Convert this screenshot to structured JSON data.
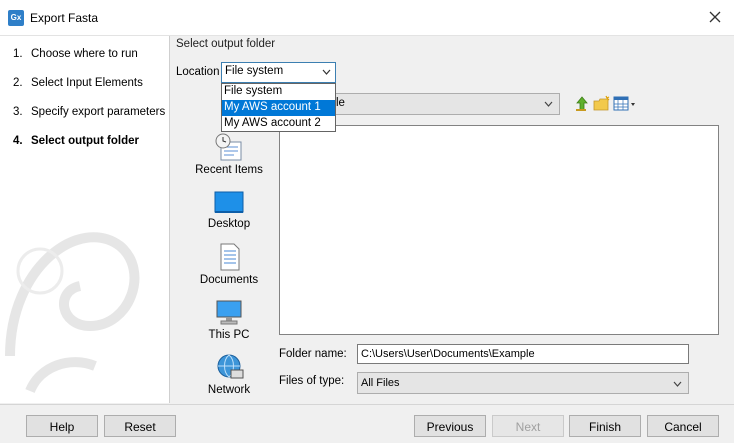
{
  "window": {
    "title": "Export Fasta",
    "app_icon_text": "Gx"
  },
  "steps": [
    {
      "num": "1.",
      "label": "Choose where to run"
    },
    {
      "num": "2.",
      "label": "Select Input Elements"
    },
    {
      "num": "3.",
      "label": "Specify export parameters"
    },
    {
      "num": "4.",
      "label": "Select output folder"
    }
  ],
  "active_step": 3,
  "main": {
    "section_title": "Select output folder",
    "location_label": "Location",
    "location_value": "File system",
    "location_options": [
      "File system",
      "My AWS account 1",
      "My AWS account 2"
    ],
    "highlighted_option": "My AWS account 1",
    "path_combo_visible_text": "le"
  },
  "places": [
    {
      "label": "Recent Items",
      "icon": "recent-items-icon"
    },
    {
      "label": "Desktop",
      "icon": "desktop-icon"
    },
    {
      "label": "Documents",
      "icon": "documents-icon"
    },
    {
      "label": "This PC",
      "icon": "this-pc-icon"
    },
    {
      "label": "Network",
      "icon": "network-icon"
    }
  ],
  "folder_name": {
    "label": "Folder name:",
    "value": "C:\\Users\\User\\Documents\\Example"
  },
  "files_of_type": {
    "label": "Files of type:",
    "value": "All Files"
  },
  "buttons": {
    "help": "Help",
    "reset": "Reset",
    "previous": "Previous",
    "next": "Next",
    "finish": "Finish",
    "cancel": "Cancel"
  },
  "colors": {
    "selection": "#0078d7",
    "focus_border": "#3c7fb1",
    "app_icon": "#2f7fc8"
  }
}
